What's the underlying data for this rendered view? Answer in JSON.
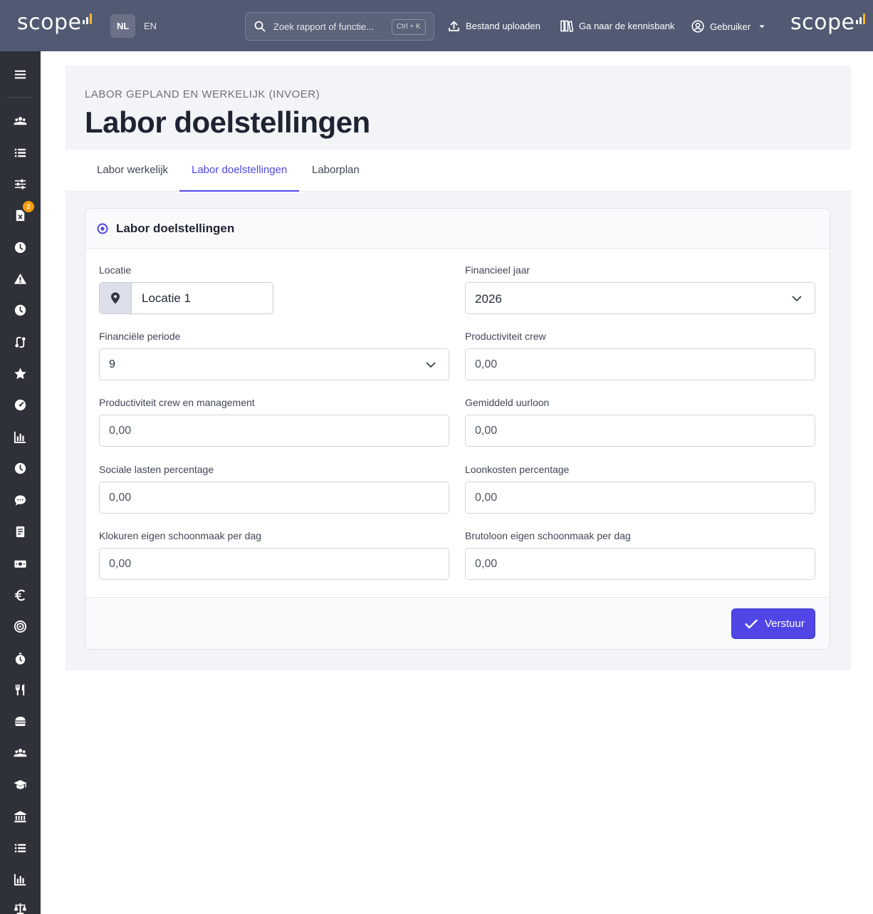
{
  "topbar": {
    "logo_text": "scope",
    "languages": [
      {
        "code": "NL",
        "active": true
      },
      {
        "code": "EN",
        "active": false
      }
    ],
    "search_placeholder": "Zoek rapport of functie...",
    "search_shortcut": "Ctrl + K",
    "upload_label": "Bestand uploaden",
    "knowledge_label": "Ga naar de kennisbank",
    "user_label": "Gebruiker"
  },
  "sidebar": {
    "items": [
      {
        "icon": "menu-icon"
      },
      {
        "icon": "users-icon"
      },
      {
        "icon": "list-icon"
      },
      {
        "icon": "sliders-icon"
      },
      {
        "icon": "excel-file-icon",
        "badge": "2"
      },
      {
        "icon": "clock-icon"
      },
      {
        "icon": "warning-icon"
      },
      {
        "icon": "clock-icon"
      },
      {
        "icon": "route-icon"
      },
      {
        "icon": "star-icon"
      },
      {
        "icon": "gauge-icon"
      },
      {
        "icon": "bar-chart-icon"
      },
      {
        "icon": "clock-icon"
      },
      {
        "icon": "chat-icon"
      },
      {
        "icon": "receipt-icon"
      },
      {
        "icon": "cash-icon"
      },
      {
        "icon": "euro-icon"
      },
      {
        "icon": "target-icon"
      },
      {
        "icon": "stopwatch-icon"
      },
      {
        "icon": "utensils-icon"
      },
      {
        "icon": "burger-icon"
      },
      {
        "icon": "users-icon"
      },
      {
        "icon": "graduation-cap-icon"
      },
      {
        "icon": "bank-icon"
      },
      {
        "icon": "list-icon"
      },
      {
        "icon": "bar-chart-icon"
      },
      {
        "icon": "scale-icon"
      }
    ]
  },
  "header": {
    "eyebrow": "LABOR GEPLAND EN WERKELIJK (INVOER)",
    "title": "Labor doelstellingen"
  },
  "tabs": [
    {
      "label": "Labor werkelijk",
      "active": false
    },
    {
      "label": "Labor doelstellingen",
      "active": true
    },
    {
      "label": "Laborplan",
      "active": false
    }
  ],
  "card": {
    "title": "Labor doelstellingen",
    "title_icon": "target-icon",
    "fields": {
      "locatie": {
        "label": "Locatie",
        "value": "Locatie 1"
      },
      "financieel_jaar": {
        "label": "Financieel jaar",
        "value": "2026"
      },
      "financiele_periode": {
        "label": "Financiële periode",
        "value": "9"
      },
      "productiviteit_crew": {
        "label": "Productiviteit crew",
        "value": "0,00"
      },
      "productiviteit_crew_management": {
        "label": "Productiviteit crew en management",
        "value": "0,00"
      },
      "gemiddeld_uurloon": {
        "label": "Gemiddeld uurloon",
        "value": "0,00"
      },
      "sociale_lasten": {
        "label": "Sociale lasten percentage",
        "value": "0,00"
      },
      "loonkosten": {
        "label": "Loonkosten percentage",
        "value": "0,00"
      },
      "klokuren_schoonmaak": {
        "label": "Klokuren eigen schoonmaak per dag",
        "value": "0,00"
      },
      "brutoloon_schoonmaak": {
        "label": "Brutoloon eigen schoonmaak per dag",
        "value": "0,00"
      }
    },
    "submit_label": "Verstuur"
  },
  "colors": {
    "topbar": "#515a72",
    "sidebar": "#2e3138",
    "accent": "#4f46e5",
    "badge": "#f59e0b"
  }
}
